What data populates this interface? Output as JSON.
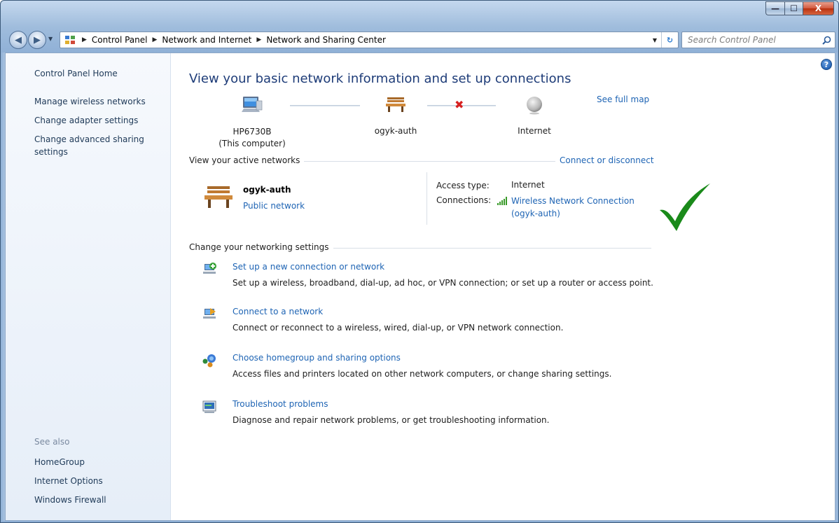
{
  "window": {
    "minimize_label": "—",
    "maximize_label": "☐",
    "close_label": "X"
  },
  "nav": {
    "back_icon": "back-arrow-icon",
    "forward_icon": "forward-arrow-icon"
  },
  "address": {
    "breadcrumbs": [
      "Control Panel",
      "Network and Internet",
      "Network and Sharing Center"
    ],
    "separator": "▶"
  },
  "search": {
    "placeholder": "Search Control Panel"
  },
  "sidebar": {
    "home": "Control Panel Home",
    "items": [
      "Manage wireless networks",
      "Change adapter settings",
      "Change advanced sharing",
      "settings"
    ],
    "see_also_label": "See also",
    "see_also": [
      "HomeGroup",
      "Internet Options",
      "Windows Firewall"
    ]
  },
  "main": {
    "title": "View your basic network information and set up connections",
    "see_full_map": "See full map",
    "map": {
      "computer_name": "HP6730B",
      "computer_sub": "(This computer)",
      "network_name": "ogyk-auth",
      "internet_label": "Internet",
      "status_colors": {
        "error": "#d62020",
        "ok": "#3a9a2a"
      }
    },
    "active_networks": {
      "label": "View your active networks",
      "connect_link": "Connect or disconnect",
      "network_name": "ogyk-auth",
      "network_category": "Public network",
      "access_type_label": "Access type:",
      "access_type_value": "Internet",
      "connections_label": "Connections:",
      "connection_link_line1": "Wireless Network Connection",
      "connection_link_line2": "(ogyk-auth)"
    },
    "settings": {
      "label": "Change your networking settings",
      "tasks": [
        {
          "link": "Set up a new connection or network",
          "desc": "Set up a wireless, broadband, dial-up, ad hoc, or VPN connection; or set up a router or access point."
        },
        {
          "link": "Connect to a network",
          "desc": "Connect or reconnect to a wireless, wired, dial-up, or VPN network connection."
        },
        {
          "link": "Choose homegroup and sharing options",
          "desc": "Access files and printers located on other network computers, or change sharing settings."
        },
        {
          "link": "Troubleshoot problems",
          "desc": "Diagnose and repair network problems, or get troubleshooting information."
        }
      ]
    }
  },
  "colors": {
    "link": "#1e64b4",
    "title": "#1e3c78",
    "checkmark": "#1a8a1a"
  }
}
